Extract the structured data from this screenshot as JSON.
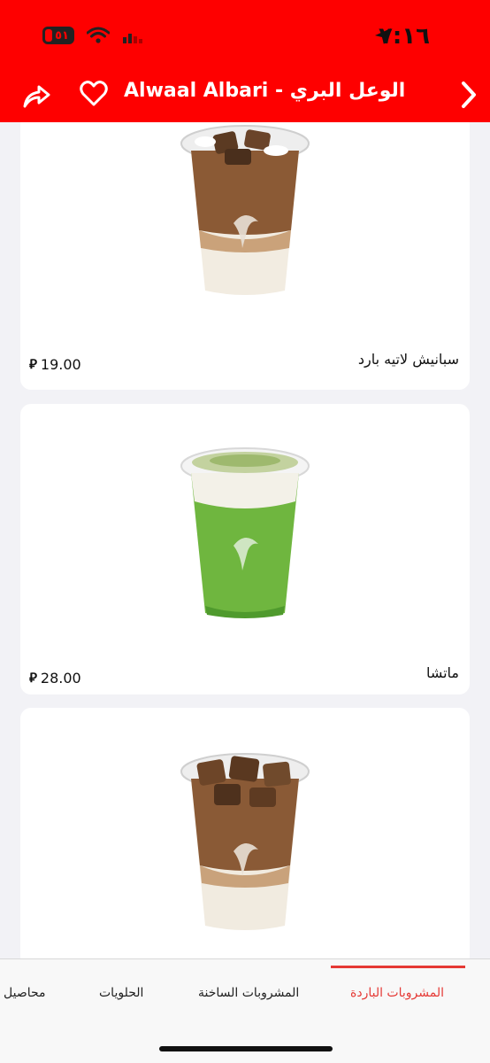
{
  "status_bar": {
    "time": "٧:١٦",
    "battery_text": "٥١",
    "icons": [
      "battery-icon",
      "wifi-icon",
      "cellular-icon",
      "location-arrow-icon"
    ]
  },
  "nav": {
    "title": "Alwaal Albari - الوعل البري",
    "icons": [
      "share-icon",
      "heart-icon",
      "chevron-right-icon"
    ]
  },
  "products": [
    {
      "name": "سبانيش لاتيه بارد",
      "price": "19.00",
      "currency_icon": "saudi-riyal-icon",
      "drink_colors": {
        "top": "#8b5a35",
        "bottom": "#f2ece1"
      }
    },
    {
      "name": "ماتشا",
      "price": "28.00",
      "currency_icon": "saudi-riyal-icon",
      "drink_colors": {
        "top": "#6fb63f",
        "bottom": "#f3f1e8"
      }
    },
    {
      "name": "",
      "price": "",
      "drink_colors": {
        "top": "#8a5a36",
        "bottom": "#f1ebe0"
      }
    }
  ],
  "tabs": [
    {
      "label": "المشروبات الباردة",
      "active": true
    },
    {
      "label": "المشروبات الساخنة",
      "active": false
    },
    {
      "label": "الحلويات",
      "active": false
    },
    {
      "label": "محاصيل",
      "active": false
    }
  ],
  "colors": {
    "brand": "#fe0000",
    "active_tab": "#e53935"
  }
}
